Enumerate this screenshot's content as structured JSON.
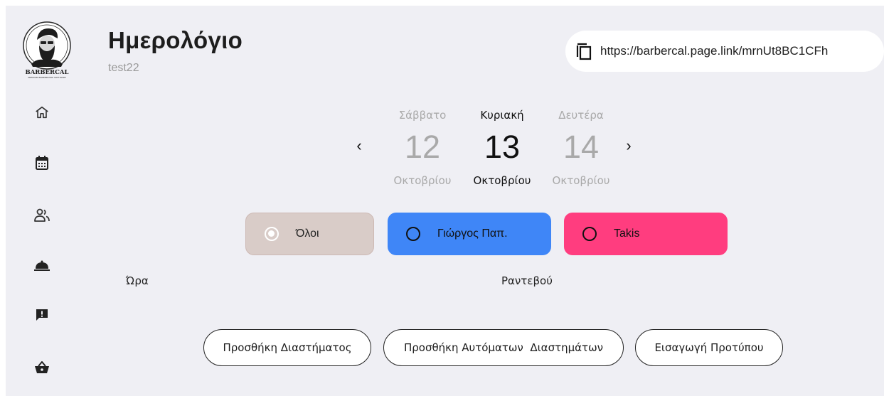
{
  "sidebar": {
    "logo_text": "BARBERCAL",
    "logo_tagline": "PREMIUM BARBERSHOP SOFTWARE",
    "items": [
      {
        "icon": "home-icon"
      },
      {
        "icon": "calendar-icon"
      },
      {
        "icon": "people-icon"
      },
      {
        "icon": "cloche-icon"
      },
      {
        "icon": "feedback-icon"
      },
      {
        "icon": "basket-icon"
      }
    ]
  },
  "header": {
    "title": "Ημερολόγιο",
    "subtitle": "test22",
    "share_link": "https://barbercal.page.link/mrnUt8BC1CFh"
  },
  "dates": {
    "prev": {
      "weekday": "Σάββατο",
      "day": "12",
      "month": "Οκτοβρίου"
    },
    "current": {
      "weekday": "Κυριακή",
      "day": "13",
      "month": "Οκτοβρίου"
    },
    "next": {
      "weekday": "Δευτέρα",
      "day": "14",
      "month": "Οκτοβρίου"
    },
    "prev_arrow": "‹",
    "next_arrow": "›"
  },
  "filters": [
    {
      "label": "Όλοι",
      "color": "#d9ccc8",
      "selected": true
    },
    {
      "label": "Γιώργος Παπ.",
      "color": "#3f86f7",
      "selected": false
    },
    {
      "label": "Takis",
      "color": "#ff3d7f",
      "selected": false
    }
  ],
  "table": {
    "col_time": "Ώρα",
    "col_appointment": "Ραντεβού"
  },
  "actions": {
    "add_slot": "Προσθήκη Διαστήματος",
    "add_auto_slots": "Προσθήκη Αυτόματων  Διαστημάτων",
    "import_template": "Εισαγωγή Προτύπου"
  }
}
